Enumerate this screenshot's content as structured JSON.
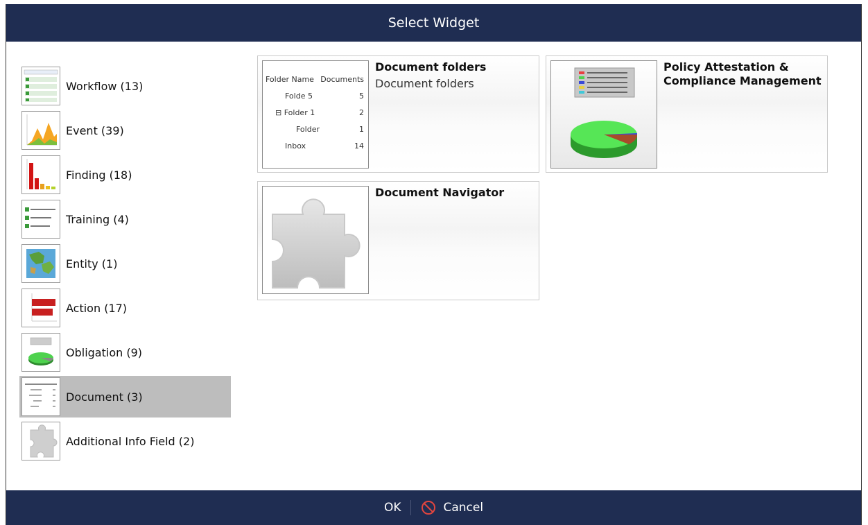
{
  "dialog": {
    "title": "Select Widget"
  },
  "categories": [
    {
      "label": "Workflow (13)",
      "icon": "workflow-thumb"
    },
    {
      "label": "Event (39)",
      "icon": "event-area-chart-thumb"
    },
    {
      "label": "Finding (18)",
      "icon": "finding-bar-chart-thumb"
    },
    {
      "label": "Training (4)",
      "icon": "training-list-thumb"
    },
    {
      "label": "Entity (1)",
      "icon": "entity-map-thumb"
    },
    {
      "label": "Action (17)",
      "icon": "action-bar-chart-thumb"
    },
    {
      "label": "Obligation (9)",
      "icon": "obligation-pie-thumb"
    },
    {
      "label": "Document (3)",
      "icon": "document-table-thumb",
      "selected": true
    },
    {
      "label": "Additional Info Field (2)",
      "icon": "puzzle-thumb"
    }
  ],
  "widgets": {
    "doc_folders": {
      "title": "Document folders",
      "description": "Document folders",
      "table": {
        "headers": [
          "Folder Name",
          "Documents"
        ],
        "rows": [
          {
            "name": "Folde 5",
            "count": "5"
          },
          {
            "name": "Folder 1",
            "count": "2",
            "collapse": "⊟"
          },
          {
            "name": "Folder",
            "count": "1"
          },
          {
            "name": "Inbox",
            "count": "14"
          }
        ]
      }
    },
    "policy": {
      "title": "Policy Attestation & Compliance Management"
    },
    "navigator": {
      "title": "Document Navigator"
    }
  },
  "footer": {
    "ok_label": "OK",
    "cancel_label": "Cancel"
  },
  "colors": {
    "header_bg": "#1f2d52",
    "selected_bg": "#bdbdbd",
    "cancel_icon": "#e0453f"
  }
}
